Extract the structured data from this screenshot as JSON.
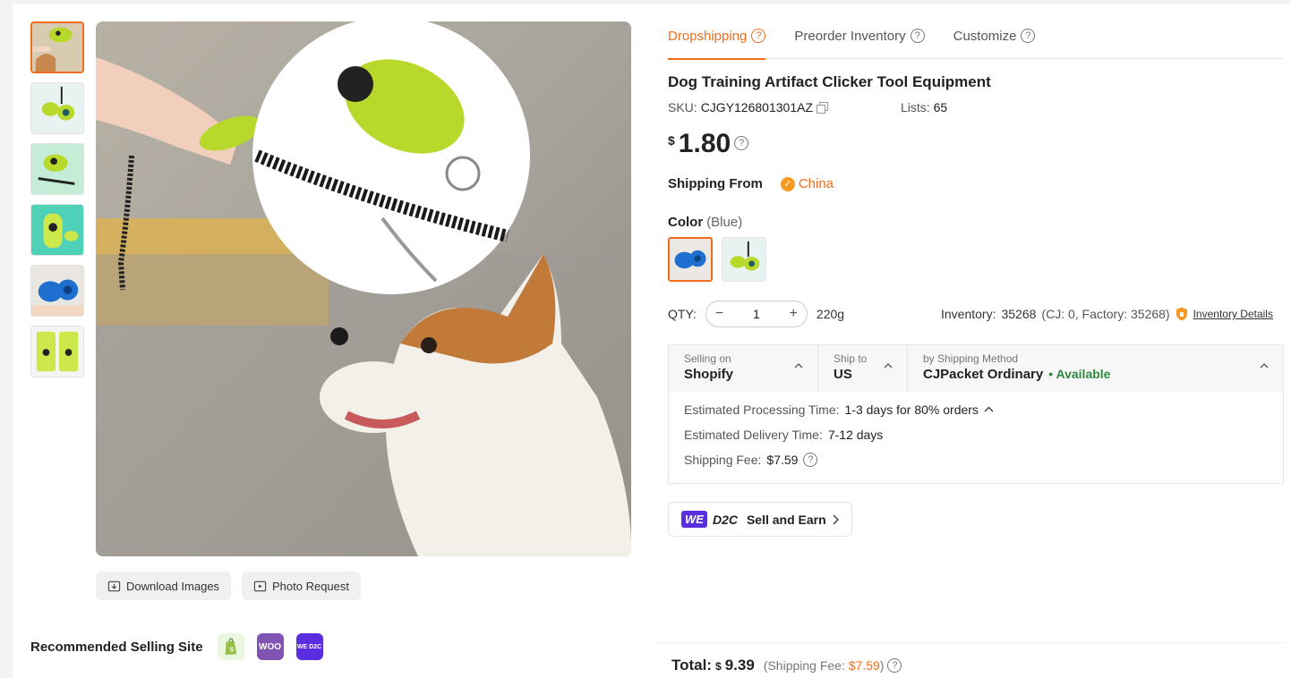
{
  "gallery": {
    "thumb_names": [
      "thumb-1",
      "thumb-2",
      "thumb-3",
      "thumb-4",
      "thumb-5",
      "thumb-6"
    ],
    "download_label": "Download Images",
    "photo_request_label": "Photo Request"
  },
  "recommended": {
    "label": "Recommended Selling Site",
    "sites": [
      "shopify-icon",
      "woo-icon",
      "we-d2c-icon"
    ],
    "woo_text": "WOO",
    "wed2c_text": "WE D2C"
  },
  "tabs": [
    {
      "label": "Dropshipping",
      "active": true
    },
    {
      "label": "Preorder Inventory",
      "active": false
    },
    {
      "label": "Customize",
      "active": false
    }
  ],
  "product": {
    "title": "Dog Training Artifact Clicker Tool Equipment",
    "sku_label": "SKU:",
    "sku": "CJGY126801301AZ",
    "lists_label": "Lists:",
    "lists": "65",
    "currency": "$",
    "price": "1.80",
    "shipping_from_label": "Shipping From",
    "shipping_from": "China",
    "color_label": "Color",
    "color_selected": "(Blue)",
    "qty_label": "QTY:",
    "qty": "1",
    "weight": "220g",
    "inventory_label": "Inventory:",
    "inventory": "35268",
    "inventory_sub": "(CJ: 0, Factory: 35268)",
    "inventory_details": "Inventory Details"
  },
  "shipping": {
    "selling_on_label": "Selling on",
    "selling_on": "Shopify",
    "ship_to_label": "Ship to",
    "ship_to": "US",
    "method_label": "by Shipping Method",
    "method": "CJPacket Ordinary",
    "availability": "• Available",
    "processing_label": "Estimated Processing Time:",
    "processing": "1-3 days for 80% orders",
    "delivery_label": "Estimated Delivery Time:",
    "delivery": "7-12 days",
    "fee_label": "Shipping Fee:",
    "fee": "$7.59"
  },
  "promo": {
    "we": "WE",
    "d2c": "D2C",
    "label": "Sell and Earn"
  },
  "total": {
    "label": "Total:",
    "currency": "$",
    "amount": "9.39",
    "fee_prefix": "(Shipping Fee:",
    "fee": "$7.59",
    "fee_suffix": ")"
  },
  "colors": {
    "accent": "#f26d1b",
    "available": "#2e8b3e"
  }
}
